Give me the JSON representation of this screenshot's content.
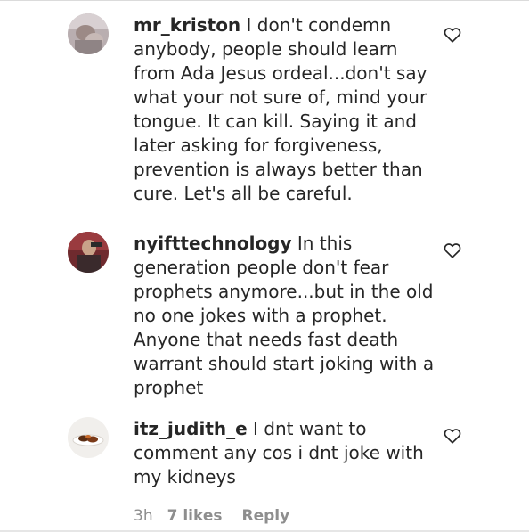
{
  "comments": [
    {
      "username": "mr_kriston",
      "text": "I don't condemn anybody, people should learn from Ada Jesus ordeal...don't say what your not sure of, mind your tongue. It can kill. Saying it and later asking for forgiveness, prevention is always better than cure. Let's all be careful.",
      "avatar_icon": "avatar-photo"
    },
    {
      "username": "nyifttechnology",
      "text": "In this generation people don't fear prophets anymore...but in the old no one jokes with a prophet. Anyone that needs fast death warrant should start joking with a prophet",
      "avatar_icon": "avatar-photo"
    },
    {
      "username": "itz_judith_e",
      "text": "I dnt want to comment any cos i dnt joke with my kidneys",
      "avatar_icon": "avatar-photo",
      "meta": {
        "time": "3h",
        "likes": "7 likes",
        "reply": "Reply"
      }
    }
  ],
  "icons": {
    "like": "heart-outline-icon"
  },
  "colors": {
    "text": "#262626",
    "secondary": "#8e8e8e"
  }
}
